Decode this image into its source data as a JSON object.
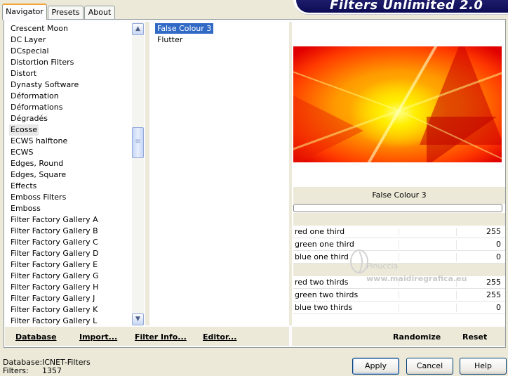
{
  "tabs": [
    {
      "label": "Navigator",
      "active": true
    },
    {
      "label": "Presets",
      "active": false
    },
    {
      "label": "About",
      "active": false
    }
  ],
  "app_title": "Filters Unlimited 2.0",
  "categories": [
    "Crescent Moon",
    "DC Layer",
    "DCspecial",
    "Distortion Filters",
    "Distort",
    "Dynasty Software",
    "Déformation",
    "Déformations",
    "Dégradés",
    "Ecosse",
    "ECWS halftone",
    "ECWS",
    "Edges, Round",
    "Edges, Square",
    "Effects",
    "Emboss Filters",
    "Emboss",
    "Filter Factory Gallery A",
    "Filter Factory Gallery B",
    "Filter Factory Gallery C",
    "Filter Factory Gallery D",
    "Filter Factory Gallery E",
    "Filter Factory Gallery G",
    "Filter Factory Gallery H",
    "Filter Factory Gallery J",
    "Filter Factory Gallery K",
    "Filter Factory Gallery L"
  ],
  "selected_category": "Ecosse",
  "filters": [
    {
      "label": "False Colour 3",
      "selected": true
    },
    {
      "label": "Flutter",
      "selected": false
    }
  ],
  "preview_filter_name": "False Colour 3",
  "parameters": [
    {
      "label": "red one third",
      "value": "255"
    },
    {
      "label": "green one third",
      "value": "0"
    },
    {
      "label": "blue one third",
      "value": "0"
    },
    {
      "label": "red two thirds",
      "value": "255"
    },
    {
      "label": "green two thirds",
      "value": "255"
    },
    {
      "label": "blue two thirds",
      "value": "0"
    }
  ],
  "watermark": {
    "line1": "Pinuccia",
    "line2": "www.maidiregrafica.eu"
  },
  "left_actions": {
    "database": "Database",
    "import": "Import...",
    "filter_info": "Filter Info...",
    "editor": "Editor..."
  },
  "right_actions": {
    "randomize": "Randomize",
    "reset": "Reset"
  },
  "status": {
    "database_label": "Database:",
    "database_value": "ICNET-Filters",
    "filters_label": "Filters:",
    "filters_value": "1357"
  },
  "dialog_buttons": {
    "apply": "Apply",
    "cancel": "Cancel",
    "help": "Help"
  },
  "colors": {
    "selection": "#316ac5",
    "banner": "#0b0b55",
    "face": "#ece9d8"
  }
}
